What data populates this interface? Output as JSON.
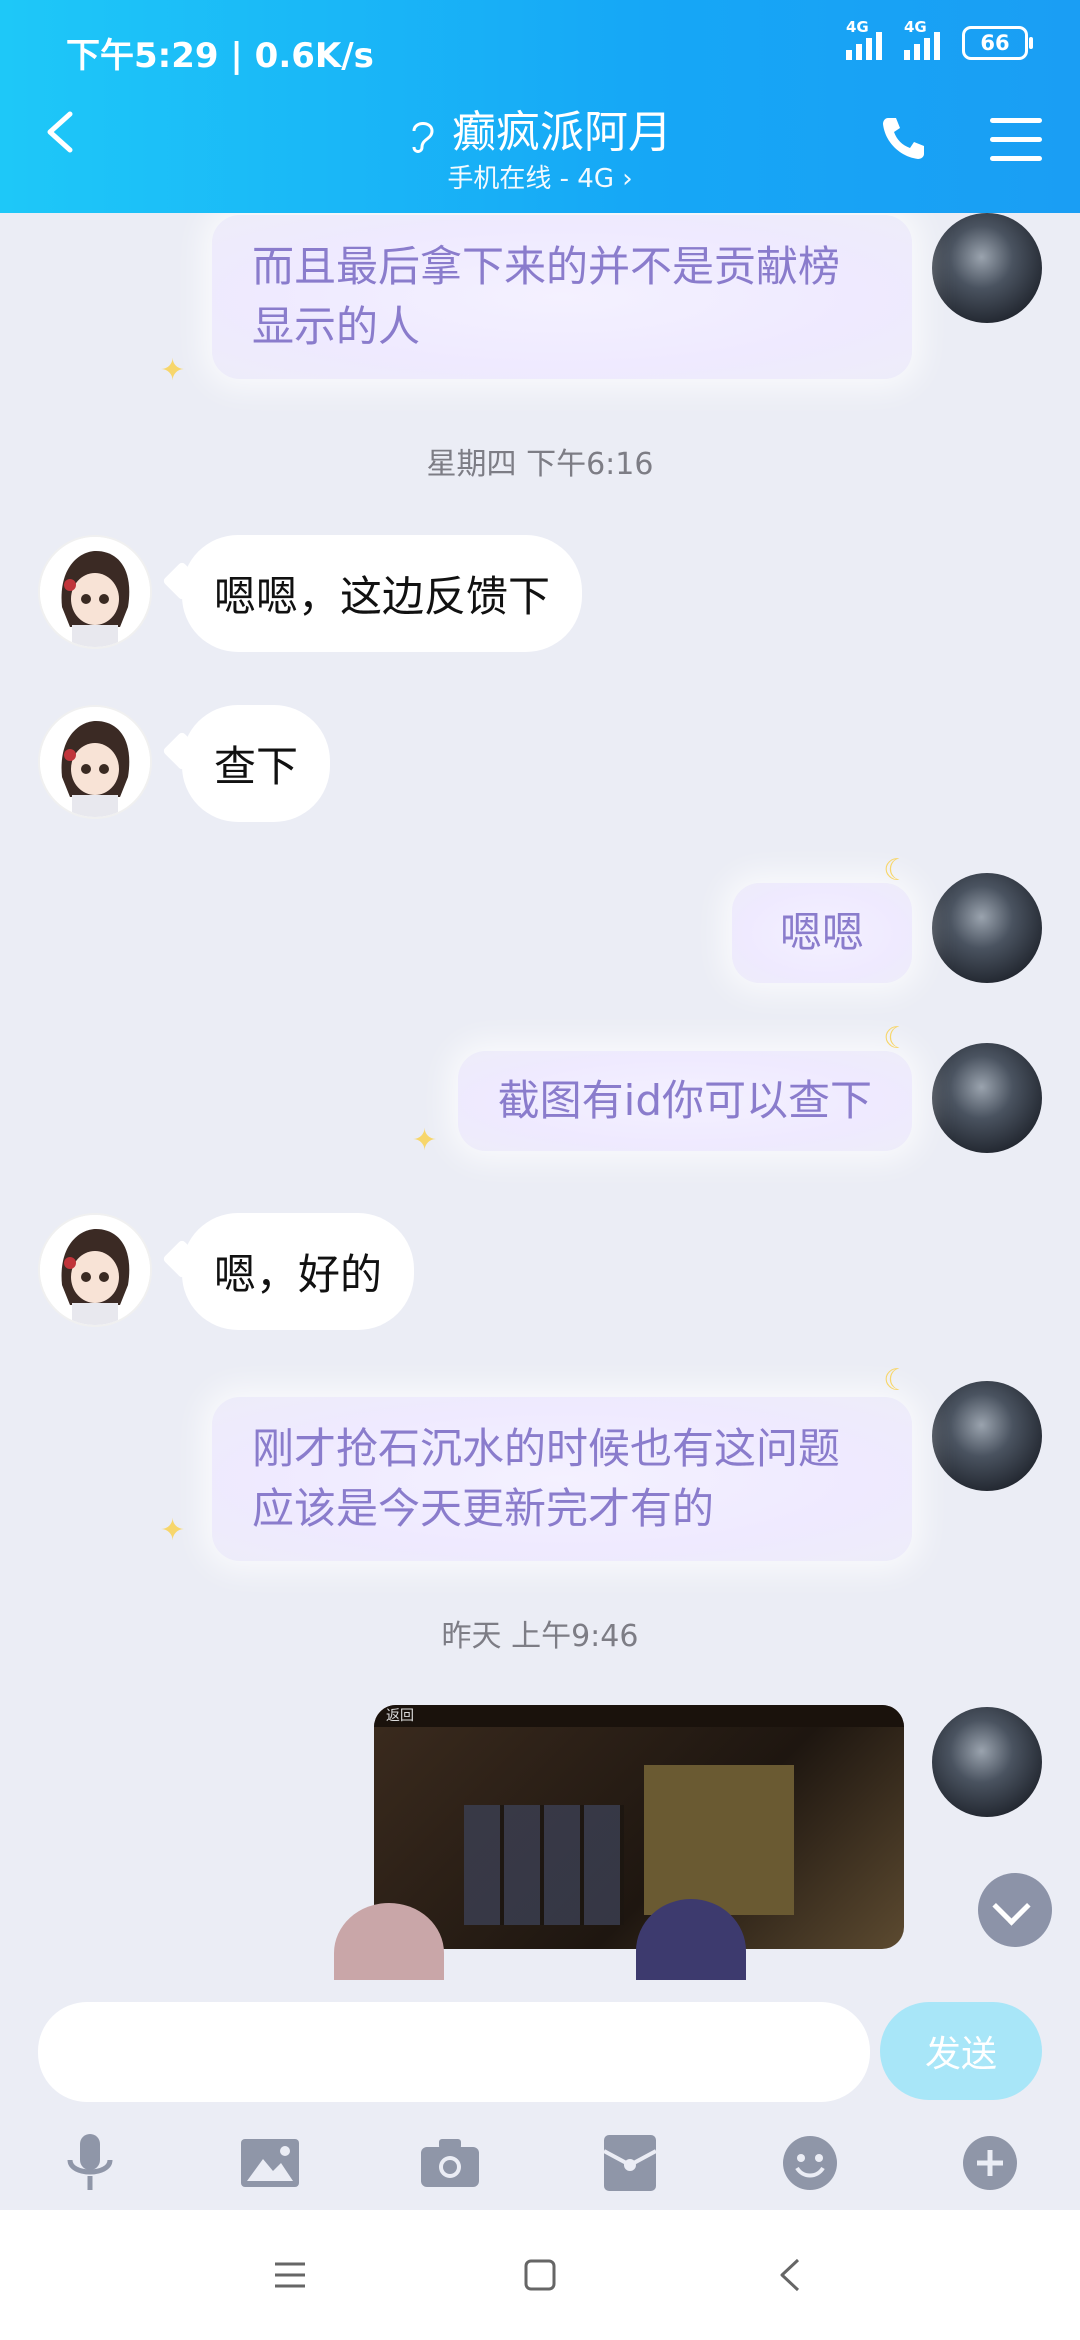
{
  "status_bar": {
    "time_speed": "下午5:29 | 0.6K/s",
    "network1": "4G",
    "network2": "4G",
    "battery": "66"
  },
  "header": {
    "title": "癫疯派阿月",
    "subtitle": "手机在线 - 4G ›"
  },
  "messages": [
    {
      "id": "m1",
      "side": "me",
      "text": "而且最后拿下来的并不是贡献榜显示的人"
    },
    {
      "id": "t1",
      "type": "time",
      "text": "星期四 下午6:16"
    },
    {
      "id": "m2",
      "side": "them",
      "text": "嗯嗯，这边反馈下"
    },
    {
      "id": "m3",
      "side": "them",
      "text": "查下"
    },
    {
      "id": "m4",
      "side": "me",
      "text": "嗯嗯"
    },
    {
      "id": "m5",
      "side": "me",
      "text": "截图有id你可以查下"
    },
    {
      "id": "m6",
      "side": "them",
      "text": "嗯，好的"
    },
    {
      "id": "m7",
      "side": "me",
      "text": "刚才抢石沉水的时候也有这问题应该是今天更新完才有的"
    },
    {
      "id": "t2",
      "type": "time",
      "text": "昨天 上午9:46"
    },
    {
      "id": "m8",
      "side": "me",
      "type": "image",
      "caption": "返回"
    }
  ],
  "input": {
    "value": "",
    "send_label": "发送"
  },
  "colors": {
    "header_start": "#1ec8f8",
    "header_end": "#1a9ef4",
    "my_text": "#8a7ccc",
    "send_button": "#a8e6f8",
    "chat_bg": "#ebedf5"
  },
  "tools": [
    "microphone-icon",
    "image-icon",
    "camera-icon",
    "red-packet-icon",
    "emoji-icon",
    "plus-icon"
  ],
  "nav": [
    "menu-icon",
    "home-icon",
    "back-icon"
  ]
}
